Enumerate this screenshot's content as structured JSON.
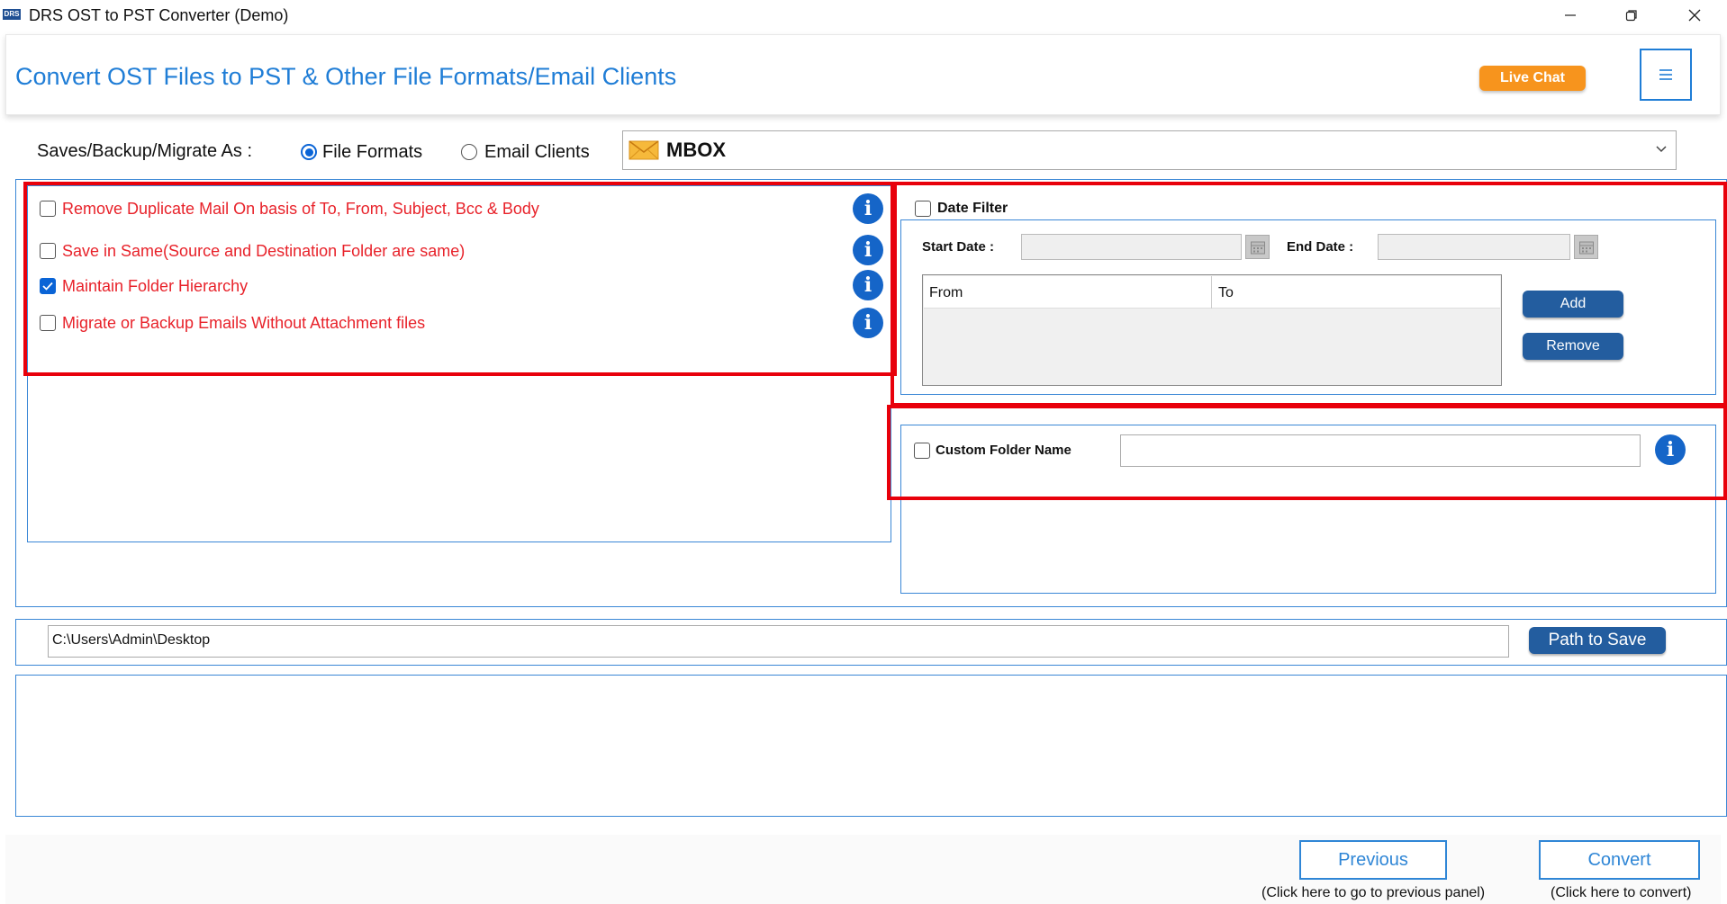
{
  "window": {
    "logo_text": "DRS",
    "title": "DRS OST to PST Converter (Demo)"
  },
  "header": {
    "title": "Convert OST Files to PST & Other File Formats/Email Clients",
    "live_chat_label": "Live Chat"
  },
  "saves_row": {
    "label": "Saves/Backup/Migrate As :",
    "options": [
      {
        "label": "File Formats",
        "selected": true
      },
      {
        "label": "Email Clients",
        "selected": false
      }
    ],
    "selected_format": "MBOX"
  },
  "options": [
    {
      "label": "Remove Duplicate Mail On basis of To, From, Subject, Bcc & Body",
      "checked": false
    },
    {
      "label": "Save in Same(Source and Destination Folder are same)",
      "checked": false
    },
    {
      "label": "Maintain Folder Hierarchy",
      "checked": true
    },
    {
      "label": "Migrate or Backup Emails Without Attachment files",
      "checked": false
    }
  ],
  "date_filter": {
    "label": "Date Filter",
    "checked": false,
    "start_label": "Start Date :",
    "end_label": "End Date :",
    "start_value": "",
    "end_value": "",
    "columns": [
      "From",
      "To"
    ],
    "add_label": "Add",
    "remove_label": "Remove"
  },
  "custom_folder": {
    "label": "Custom Folder Name",
    "checked": false,
    "value": ""
  },
  "path": {
    "value": "C:\\Users\\Admin\\Desktop",
    "button_label": "Path to Save"
  },
  "footer": {
    "previous_label": "Previous",
    "previous_hint": "(Click here to go to previous panel)",
    "convert_label": "Convert",
    "convert_hint": "(Click here to convert)"
  },
  "colors": {
    "accent_blue": "#1f7dd6",
    "highlight_red": "#e8000b",
    "option_red": "#e8222a",
    "live_chat_orange": "#f7941d",
    "navy_button": "#235d9f"
  }
}
